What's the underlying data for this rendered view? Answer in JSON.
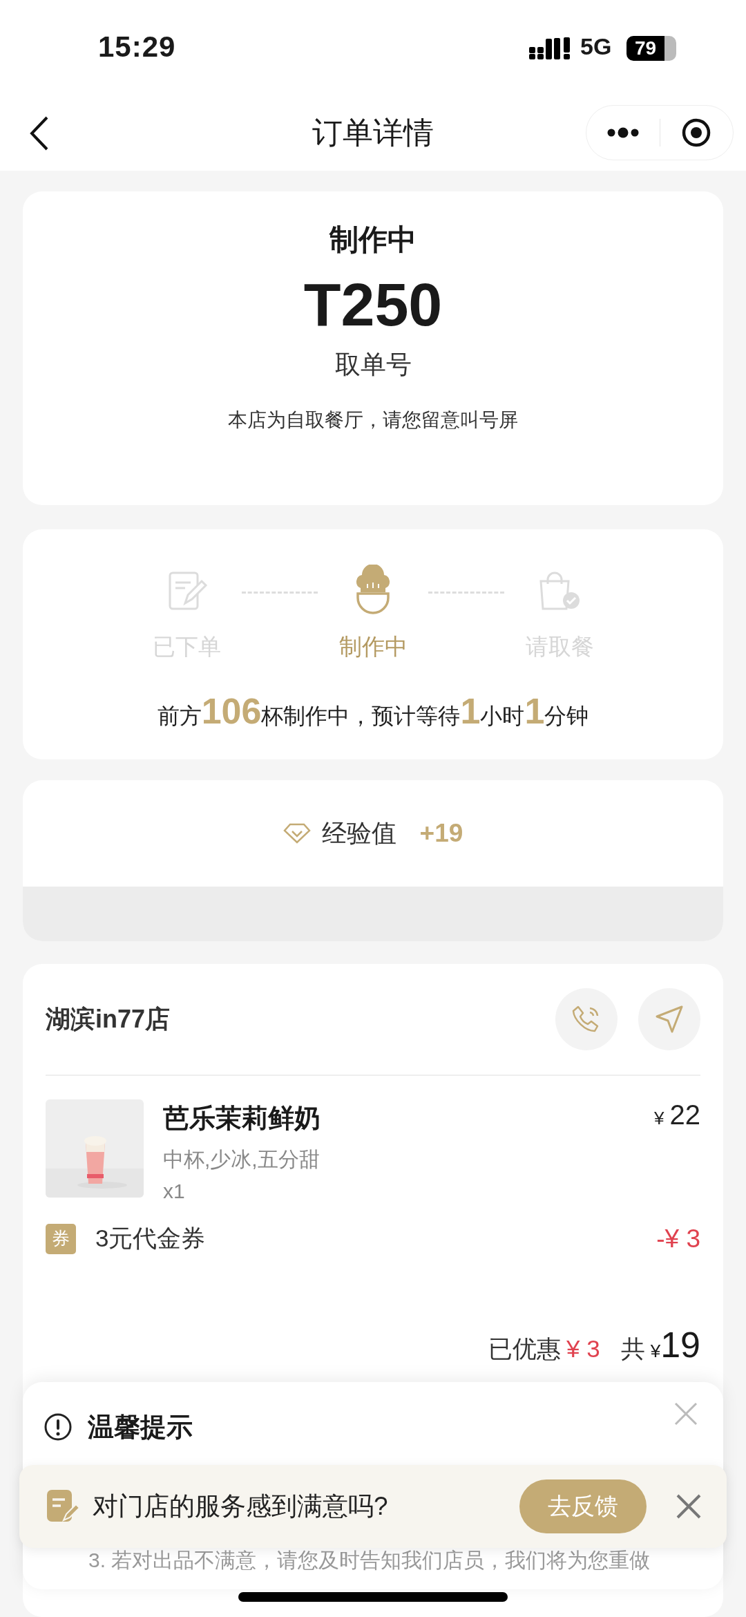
{
  "status_bar": {
    "time": "15:29",
    "network": "5G",
    "battery": "79"
  },
  "nav": {
    "title": "订单详情"
  },
  "order_status": {
    "status": "制作中",
    "pickup_number": "T250",
    "pickup_label": "取单号",
    "note": "本店为自取餐厅，请您留意叫号屏"
  },
  "progress": {
    "steps": [
      {
        "label": "已下单",
        "kind": "order",
        "selected": false
      },
      {
        "label": "制作中",
        "kind": "making",
        "selected": true
      },
      {
        "label": "请取餐",
        "kind": "pickup",
        "selected": false
      }
    ],
    "queue": [
      {
        "text": "前方",
        "kind": "text"
      },
      {
        "text": "106",
        "kind": "number"
      },
      {
        "text": "杯制作中，预计等待",
        "kind": "text"
      },
      {
        "text": "1",
        "kind": "number"
      },
      {
        "text": "小时",
        "kind": "text"
      },
      {
        "text": "1",
        "kind": "number"
      },
      {
        "text": "分钟",
        "kind": "text"
      }
    ]
  },
  "experience": {
    "label": "经验值",
    "value": "+19"
  },
  "store": {
    "name": "湖滨in77店",
    "items": [
      {
        "name": "芭乐茉莉鲜奶",
        "specs": "中杯,少冰,五分甜",
        "quantity": "x1",
        "currency": "¥",
        "price": "22"
      }
    ],
    "coupon": {
      "badge": "券",
      "label": "3元代金券",
      "amount": "-¥ 3"
    },
    "totals": {
      "discount_label": "已优惠",
      "discount": "¥ 3",
      "total_label": "共",
      "currency": "¥",
      "total": "19"
    }
  },
  "tip": {
    "title": "温馨提示",
    "line": "3. 若对出品不满意，请您及时告知我们店员，我们将为您重做"
  },
  "feedback": {
    "question": "对门店的服务感到满意吗?",
    "button": "去反馈"
  }
}
